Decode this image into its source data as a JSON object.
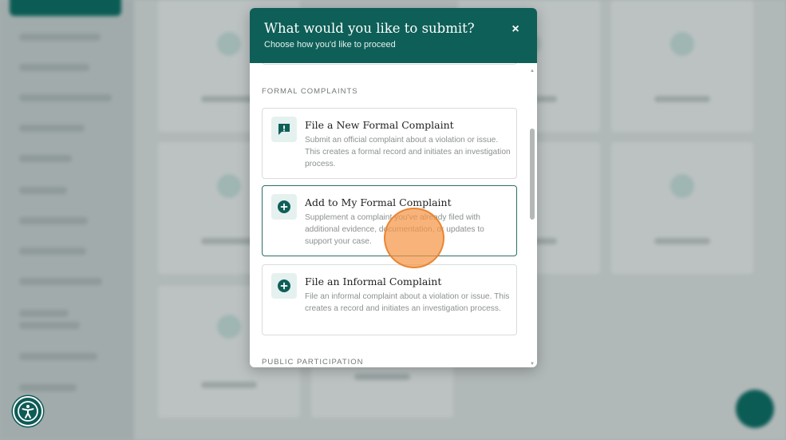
{
  "modal": {
    "title": "What would you like to submit?",
    "subtitle": "Choose how you'd like to proceed",
    "close_label": "×"
  },
  "sections": [
    {
      "label": "FORMAL COMPLAINTS",
      "options": [
        {
          "title": "File a New Formal Complaint",
          "description": "Submit an official complaint about a violation or issue. This creates a formal record and initiates an investigation process.",
          "icon": "alert-icon",
          "selected": false
        },
        {
          "title": "Add to My Formal Complaint",
          "description": "Supplement a complaint you've already filed with additional evidence, documentation, or updates to support your case.",
          "icon": "plus-circle-icon",
          "selected": true
        },
        {
          "title": "File an Informal Complaint",
          "description": "File an informal complaint about a violation or issue. This creates a record and initiates an investigation process.",
          "icon": "plus-circle-icon",
          "selected": false
        }
      ]
    },
    {
      "label": "PUBLIC PARTICIPATION",
      "options": []
    }
  ],
  "colors": {
    "brand": "#0e5f58",
    "icon_bg": "#e5f1ef",
    "selected_border": "#2a6f68",
    "click_marker": "#f49646"
  },
  "accessibility_button": {
    "icon": "accessibility-icon"
  }
}
